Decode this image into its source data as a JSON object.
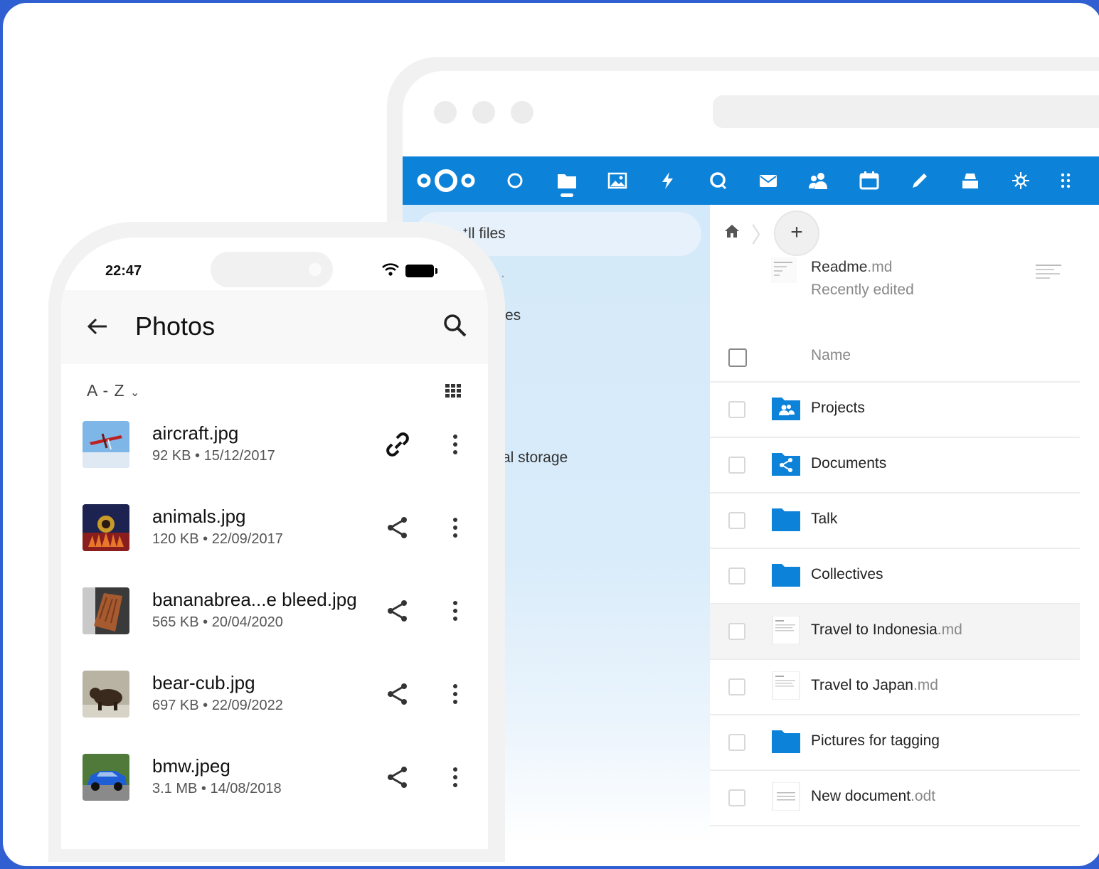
{
  "colors": {
    "brand_blue": "#0d82d9",
    "frame_blue": "#2f5fd0"
  },
  "desktop": {
    "nav_icons": [
      "circle-icon",
      "files-icon",
      "photos-icon",
      "activity-icon",
      "talk-icon",
      "mail-icon",
      "contacts-icon",
      "calendar-icon",
      "notes-icon",
      "deck-icon",
      "apps-icon"
    ],
    "sidebar": {
      "all_files": "ᐩll files",
      "item2": "es",
      "item3": "al storage"
    },
    "recent": {
      "name": "Readme",
      "ext": ".md",
      "subtitle": "Recently edited"
    },
    "header": {
      "name_col": "Name"
    },
    "files": [
      {
        "name": "Projects",
        "ext": "",
        "type": "folder-users"
      },
      {
        "name": "Documents",
        "ext": "",
        "type": "folder-shared"
      },
      {
        "name": "Talk",
        "ext": "",
        "type": "folder"
      },
      {
        "name": "Collectives",
        "ext": "",
        "type": "folder"
      },
      {
        "name": "Travel to Indonesia",
        "ext": ".md",
        "type": "doc"
      },
      {
        "name": "Travel to Japan",
        "ext": ".md",
        "type": "doc"
      },
      {
        "name": "Pictures for tagging",
        "ext": "",
        "type": "folder"
      },
      {
        "name": "New document",
        "ext": ".odt",
        "type": "odt"
      }
    ]
  },
  "mobile": {
    "status_time": "22:47",
    "title": "Photos",
    "sort": "A - Z",
    "photos": [
      {
        "name": "aircraft.jpg",
        "meta": "92 KB • 15/12/2017",
        "action": "link-icon"
      },
      {
        "name": "animals.jpg",
        "meta": "120 KB • 22/09/2017",
        "action": "share-icon"
      },
      {
        "name": "bananabrea...e bleed.jpg",
        "meta": "565 KB • 20/04/2020",
        "action": "share-icon"
      },
      {
        "name": "bear-cub.jpg",
        "meta": "697 KB • 22/09/2022",
        "action": "share-icon"
      },
      {
        "name": "bmw.jpeg",
        "meta": "3.1 MB • 14/08/2018",
        "action": "share-icon"
      }
    ]
  }
}
